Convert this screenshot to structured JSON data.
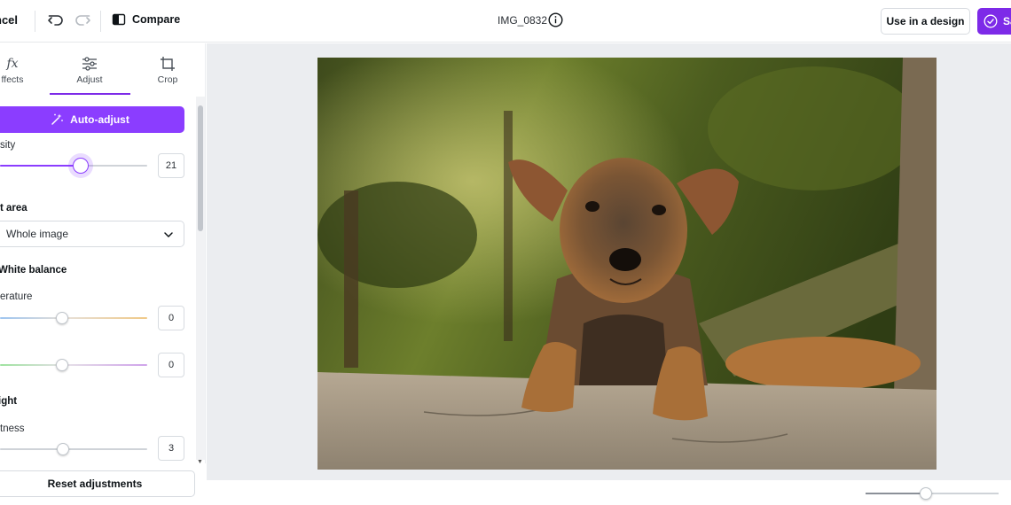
{
  "topbar": {
    "cancel_label": "ncel",
    "compare_label": "Compare",
    "file_title": "IMG_0832",
    "use_in_design_label": "Use in a design",
    "save_label": "Sa"
  },
  "tabs": [
    {
      "label": "ffects",
      "icon": "fx-icon"
    },
    {
      "label": "Adjust",
      "icon": "sliders-icon",
      "active": true
    },
    {
      "label": "Crop",
      "icon": "crop-icon"
    }
  ],
  "auto_adjust_label": "Auto-adjust",
  "intensity": {
    "label": "sity",
    "value": "21",
    "fraction": 0.55
  },
  "select_area": {
    "label": "t area",
    "value": "Whole image"
  },
  "white_balance": {
    "label": "White balance",
    "temperature": {
      "label": "erature",
      "value": "0",
      "fraction": 0.42
    },
    "tint": {
      "value": "0",
      "fraction": 0.42
    }
  },
  "light": {
    "label": "ight",
    "brightness": {
      "label": "tness",
      "value": "3",
      "fraction": 0.43
    }
  },
  "reset_label": "Reset adjustments",
  "zoom": {
    "fraction": 0.45
  },
  "colors": {
    "accent": "#8b3dff",
    "brand": "#7d2ae8"
  }
}
